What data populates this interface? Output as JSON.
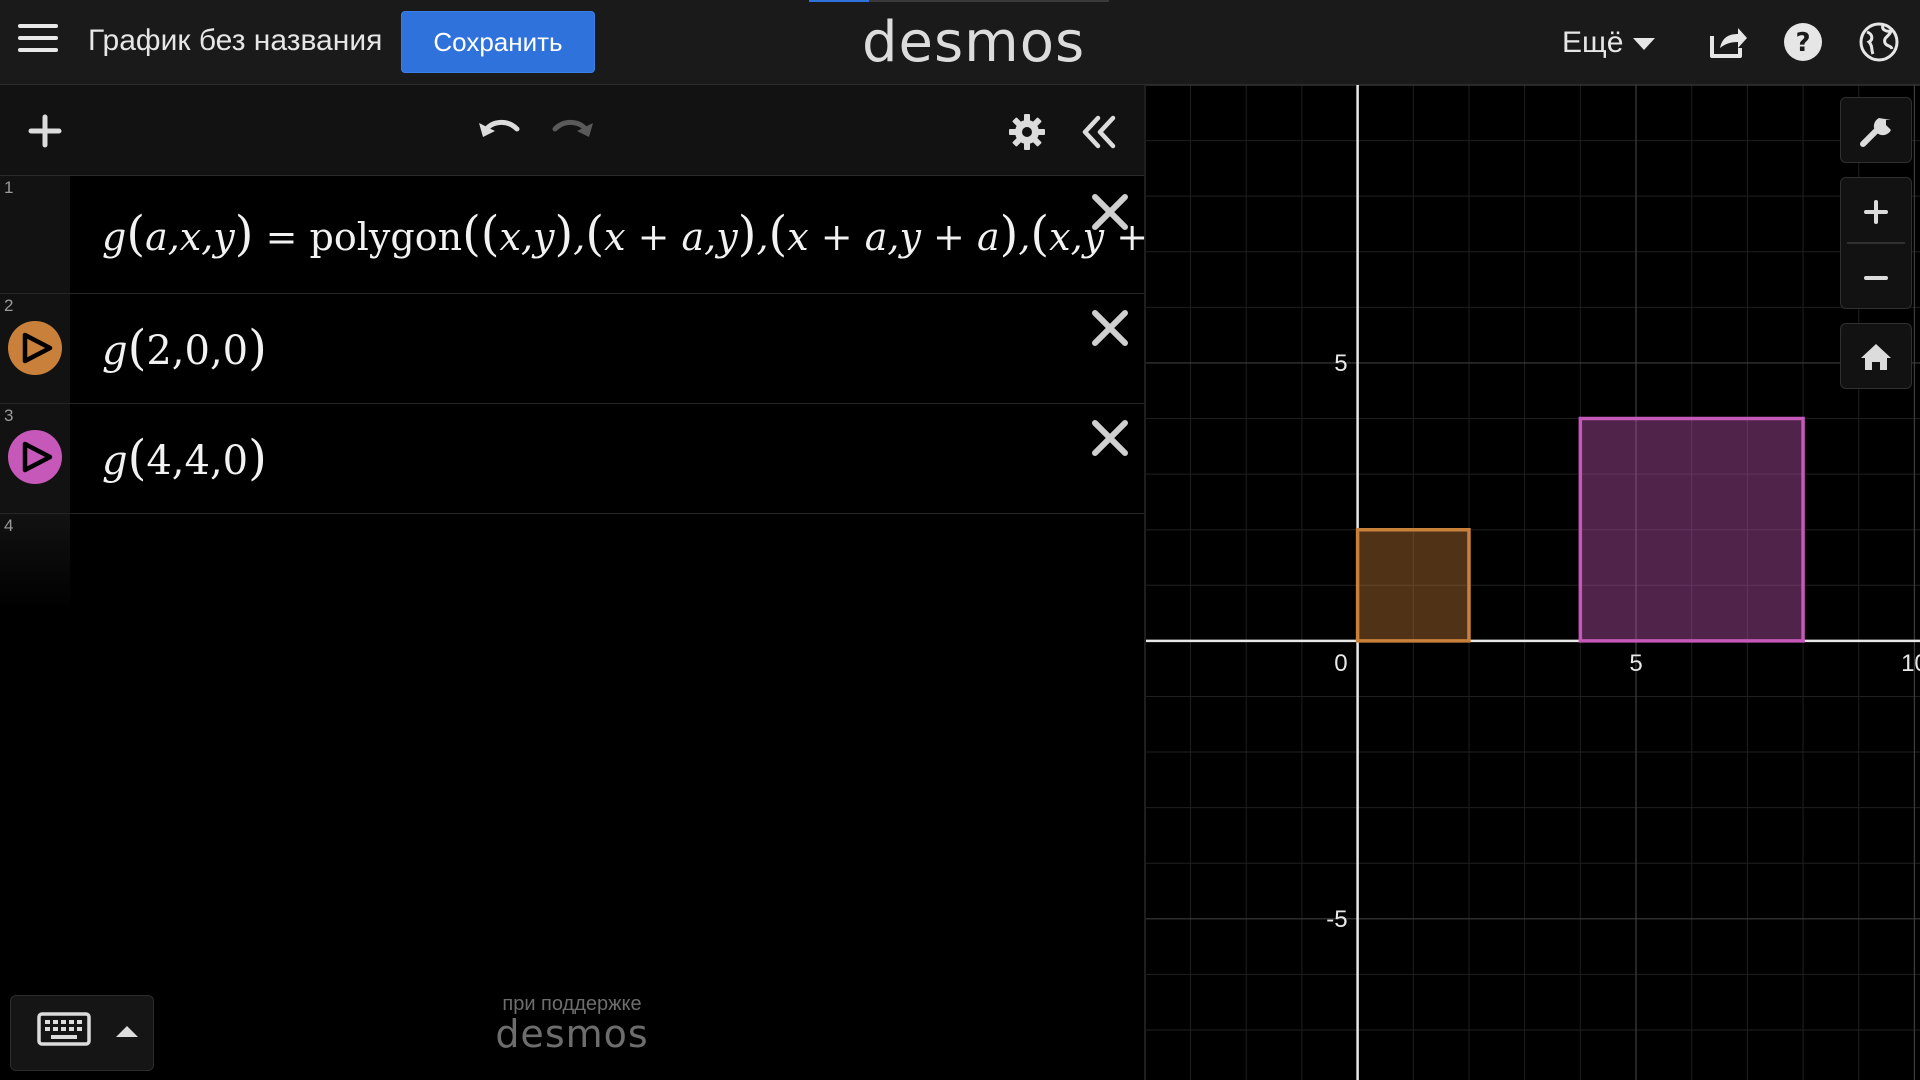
{
  "header": {
    "graph_title": "График без названия",
    "save_label": "Сохранить",
    "brand": "desmos",
    "more_label": "Ещё"
  },
  "expressions": [
    {
      "index": "1",
      "latex_text": "g(a,x,y) = polygon((x,y),(x+a,y),(x+a,y+a),(x,y+a))",
      "color": null
    },
    {
      "index": "2",
      "latex_text": "g(2,0,0)",
      "color": "#c9803a"
    },
    {
      "index": "3",
      "latex_text": "g(4,4,0)",
      "color": "#c558b8"
    },
    {
      "index": "4",
      "latex_text": "",
      "color": null
    }
  ],
  "footer": {
    "powered_by": "при поддержке",
    "powered_logo": "desmos"
  },
  "chart_data": {
    "type": "polygon",
    "xlim": [
      -3.8,
      10.1
    ],
    "ylim": [
      -7.9,
      10
    ],
    "grid": true,
    "minor_step": 1,
    "major_step": 5,
    "x_ticks": [
      "0",
      "5",
      "10"
    ],
    "y_ticks": [
      "5",
      "-5"
    ],
    "polygons": [
      {
        "vertices": [
          [
            0,
            0
          ],
          [
            2,
            0
          ],
          [
            2,
            2
          ],
          [
            0,
            2
          ]
        ],
        "stroke": "#c9803a",
        "fill": "#c9803a"
      },
      {
        "vertices": [
          [
            4,
            0
          ],
          [
            8,
            0
          ],
          [
            8,
            4
          ],
          [
            4,
            4
          ]
        ],
        "stroke": "#c558b8",
        "fill": "#c558b8"
      }
    ]
  }
}
